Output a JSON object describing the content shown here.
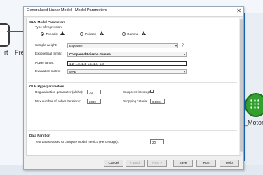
{
  "background": {
    "left_node_label_1": "rt",
    "left_node_label_2": "Fre",
    "right_node_label": "_Motor_",
    "green_color": "#32a02e",
    "blue_strip_color": "#1e73c8"
  },
  "dialog": {
    "title": "Generalized Linear Model - Model Parameters",
    "close_icon": "close-icon"
  },
  "glm_model_params": {
    "section_title": "GLM Model Parameters",
    "type_of_regression_label": "Type of regression:",
    "regression_options": [
      "Tweedie",
      "Poisson",
      "Gamma"
    ],
    "selected_regression": "Tweedie",
    "sample_weight_label": "Sample weight:",
    "sample_weight_value": "Exposure",
    "exponential_family_label": "Exponential family:",
    "exponential_family_value": "Compound Poisson Gamma",
    "power_range_label": "Power range:",
    "power_range_value": "1.2, 1.3, 1.4, 1.5, 1.6, 1.8",
    "evaluation_metric_label": "Evaluation metric:",
    "evaluation_metric_value": "MAE"
  },
  "glm_hyperparameters": {
    "section_title": "GLM Hyperparameters",
    "regularization_label": "Regularization parameter (alpha):",
    "regularization_value": "10",
    "suppress_intercept_label": "Suppress intercept:",
    "max_iterations_label": "Max number of solver iterations:",
    "max_iterations_value": "2000",
    "stopping_criteria_label": "Stopping criteria:",
    "stopping_criteria_value": "0.0001"
  },
  "data_partition": {
    "section_title": "Data Partition",
    "test_dataset_label": "Test dataset used to compute model metrics (Percentage):",
    "test_dataset_value": "20"
  },
  "buttons": {
    "cancel": "Cancel",
    "back": "< Back",
    "next": "Next >",
    "save": "Save",
    "run": "Run",
    "help": "Help"
  }
}
